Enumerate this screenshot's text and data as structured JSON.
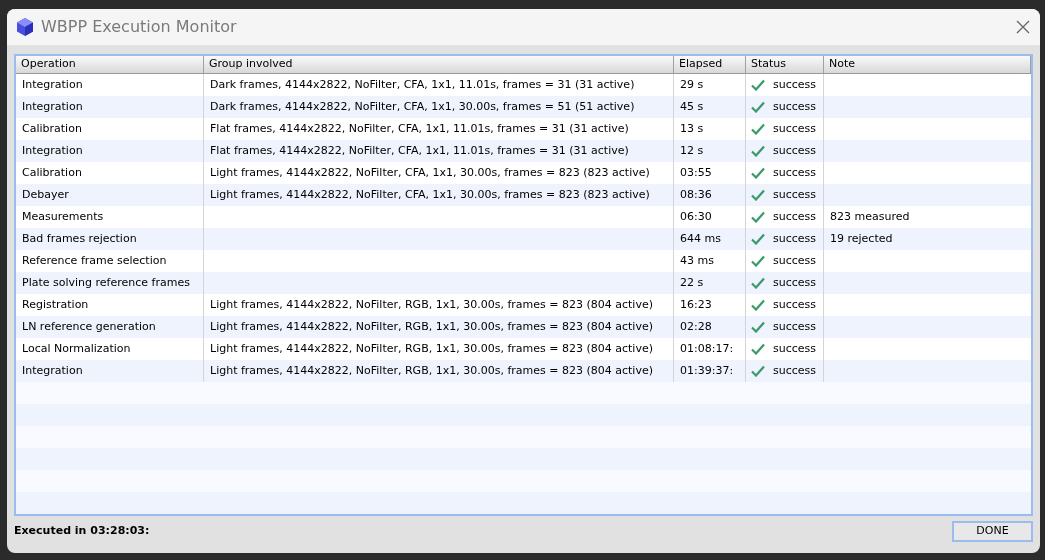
{
  "window": {
    "title": "WBPP Execution Monitor"
  },
  "table": {
    "columns": [
      "Operation",
      "Group involved",
      "Elapsed",
      "Status",
      "Note"
    ],
    "rows": [
      {
        "operation": "Integration",
        "group": "Dark frames, 4144x2822, NoFilter, CFA, 1x1, 11.01s, frames = 31 (31 active)",
        "elapsed": "29 s",
        "status": "success",
        "kind": "success"
      },
      {
        "operation": "Integration",
        "group": "Dark frames, 4144x2822, NoFilter, CFA, 1x1, 30.00s, frames = 51 (51 active)",
        "elapsed": "45 s",
        "status": "success",
        "kind": "success"
      },
      {
        "operation": "Calibration",
        "group": "Flat frames, 4144x2822, NoFilter, CFA, 1x1, 11.01s, frames = 31 (31 active)",
        "elapsed": "13 s",
        "status": "success",
        "kind": "success"
      },
      {
        "operation": "Integration",
        "group": "Flat frames, 4144x2822, NoFilter, CFA, 1x1, 11.01s, frames = 31 (31 active)",
        "elapsed": "12 s",
        "status": "success",
        "kind": "success"
      },
      {
        "operation": "Calibration",
        "group": "Light frames, 4144x2822, NoFilter, CFA, 1x1, 30.00s, frames = 823 (823 active)",
        "elapsed": "03:55",
        "status": "success",
        "kind": "success"
      },
      {
        "operation": "Debayer",
        "group": "Light frames, 4144x2822, NoFilter, CFA, 1x1, 30.00s, frames = 823 (823 active)",
        "elapsed": "08:36",
        "status": "success",
        "kind": "success"
      },
      {
        "operation": "Measurements",
        "elapsed": "06:30",
        "status": "success",
        "kind": "success",
        "note": "823 measured"
      },
      {
        "operation": "Bad frames rejection",
        "elapsed": "644 ms",
        "status": "success",
        "kind": "success",
        "note": "19 rejected"
      },
      {
        "operation": "Reference frame selection",
        "elapsed": "43 ms",
        "status": "success",
        "kind": "success"
      },
      {
        "operation": "Plate solving reference frames",
        "elapsed": "22 s",
        "status": "success",
        "kind": "success"
      },
      {
        "operation": "Registration",
        "group": "Light frames, 4144x2822, NoFilter, RGB, 1x1, 30.00s, frames = 823 (804 active)",
        "elapsed": "16:23",
        "status": "success",
        "kind": "success"
      },
      {
        "operation": "LN reference generation",
        "group": "Light frames, 4144x2822, NoFilter, RGB, 1x1, 30.00s, frames = 823 (804 active)",
        "elapsed": "02:28",
        "status": "success",
        "kind": "success"
      },
      {
        "operation": "Local Normalization",
        "group": "Light frames, 4144x2822, NoFilter, RGB, 1x1, 30.00s, frames = 823 (804 active)",
        "elapsed": "01:08:17:",
        "status": "success",
        "kind": "success"
      },
      {
        "operation": "Integration",
        "group": "Light frames, 4144x2822, NoFilter, RGB, 1x1, 30.00s, frames = 823 (804 active)",
        "elapsed": "01:39:37:",
        "status": "success",
        "kind": "success"
      }
    ]
  },
  "status_bar": {
    "summary": "Executed in 03:28:03:"
  },
  "buttons": [
    "DONE"
  ]
}
